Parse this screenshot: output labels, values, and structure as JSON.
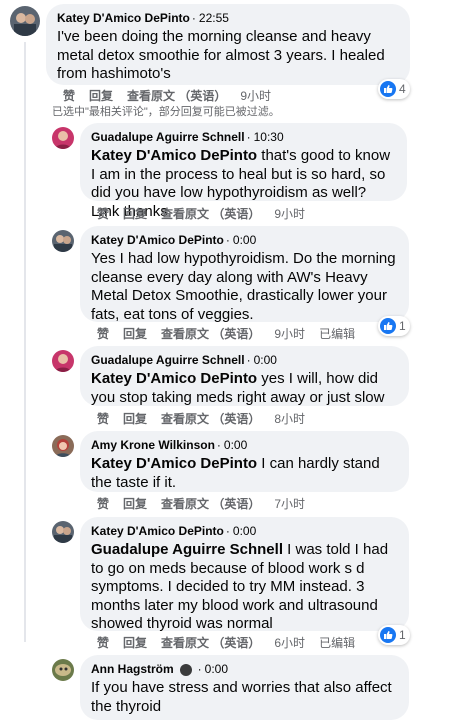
{
  "main": {
    "author": "Katey D'Amico DePinto",
    "time": "22:55",
    "text": "I've been doing the morning cleanse and heavy metal detox smoothie for almost 3 years. I healed from hashimoto's",
    "like": "赞",
    "reply": "回复",
    "see_original": "查看原文 （英语）",
    "age": "9小时",
    "reactions": "4"
  },
  "filter_note": "已选中\"最相关评论\"，部分回复可能已被过滤。",
  "replies": [
    {
      "author": "Guadalupe Aguirre Schnell",
      "time": "10:30",
      "mention": "Katey D'Amico DePinto",
      "text": " that's good to know I am in the process to heal but is so hard, so did you have low hypothyroidism as well? Lmk thanks",
      "like": "赞",
      "reply": "回复",
      "see_original": "查看原文 （英语）",
      "age": "9小时"
    },
    {
      "author": "Katey D'Amico DePinto",
      "time": "0:00",
      "text": "Yes I had low hypothyroidism. Do the morning cleanse every day along with AW's Heavy Metal Detox Smoothie, drastically lower your fats, eat tons of veggies.",
      "like": "赞",
      "reply": "回复",
      "see_original": "查看原文 （英语）",
      "age": "9小时",
      "edited": "已编辑",
      "reactions": "1"
    },
    {
      "author": "Guadalupe Aguirre Schnell",
      "time": "0:00",
      "mention": "Katey D'Amico DePinto",
      "text": " yes I will, how did you stop taking meds right away or just slow",
      "like": "赞",
      "reply": "回复",
      "see_original": "查看原文 （英语）",
      "age": "8小时"
    },
    {
      "author": "Amy Krone Wilkinson",
      "time": "0:00",
      "mention": "Katey D'Amico DePinto",
      "text": " I can hardly stand the taste if it.",
      "like": "赞",
      "reply": "回复",
      "see_original": "查看原文 （英语）",
      "age": "7小时"
    },
    {
      "author": "Katey D'Amico DePinto",
      "time": "0:00",
      "mention": "Guadalupe Aguirre Schnell",
      "text": " I was told I had to go on meds because of blood work s d symptoms. I decided to try MM instead. 3 months later my blood work and ultrasound showed thyroid was normal",
      "like": "赞",
      "reply": "回复",
      "see_original": "查看原文 （英语）",
      "age": "6小时",
      "edited": "已编辑",
      "reactions": "1"
    },
    {
      "author": "Ann Hagström",
      "time": "0:00",
      "text": "If you have stress and worries that also affect the thyroid"
    }
  ]
}
